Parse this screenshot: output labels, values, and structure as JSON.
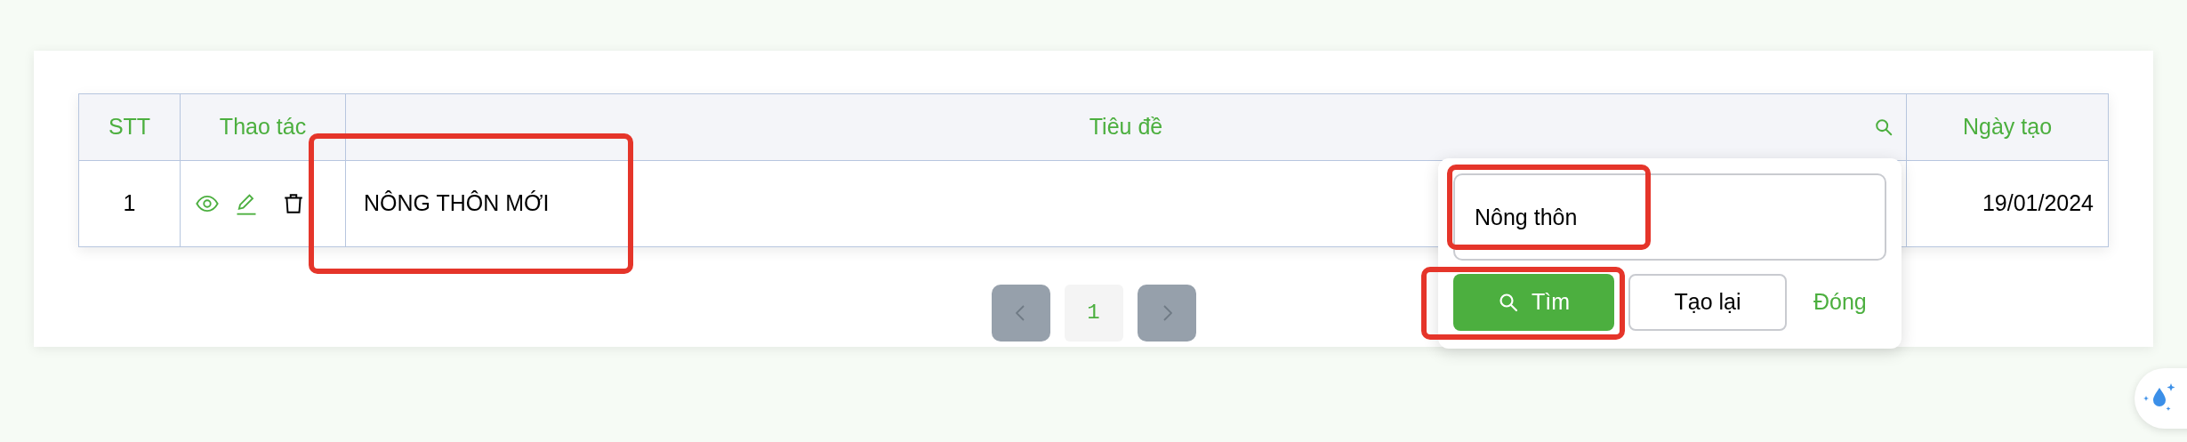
{
  "table": {
    "columns": [
      {
        "label": "STT",
        "searchable": false
      },
      {
        "label": "Thao tác",
        "searchable": false
      },
      {
        "label": "Tiêu đề",
        "searchable": true
      },
      {
        "label": "Ngày tạo",
        "searchable": false
      }
    ],
    "rows": [
      {
        "stt": "1",
        "title": "NÔNG THÔN MỚI",
        "created": "19/01/2024"
      }
    ]
  },
  "search_popup": {
    "value": "Nông thôn",
    "buttons": [
      {
        "label": "Tìm",
        "kind": "primary"
      },
      {
        "label": "Tạo lại",
        "kind": "outline"
      },
      {
        "label": "Đóng",
        "kind": "link"
      }
    ]
  },
  "pagination": {
    "prev_disabled": true,
    "next_disabled": true,
    "pages": [
      {
        "label": "1",
        "selected": true
      }
    ]
  }
}
